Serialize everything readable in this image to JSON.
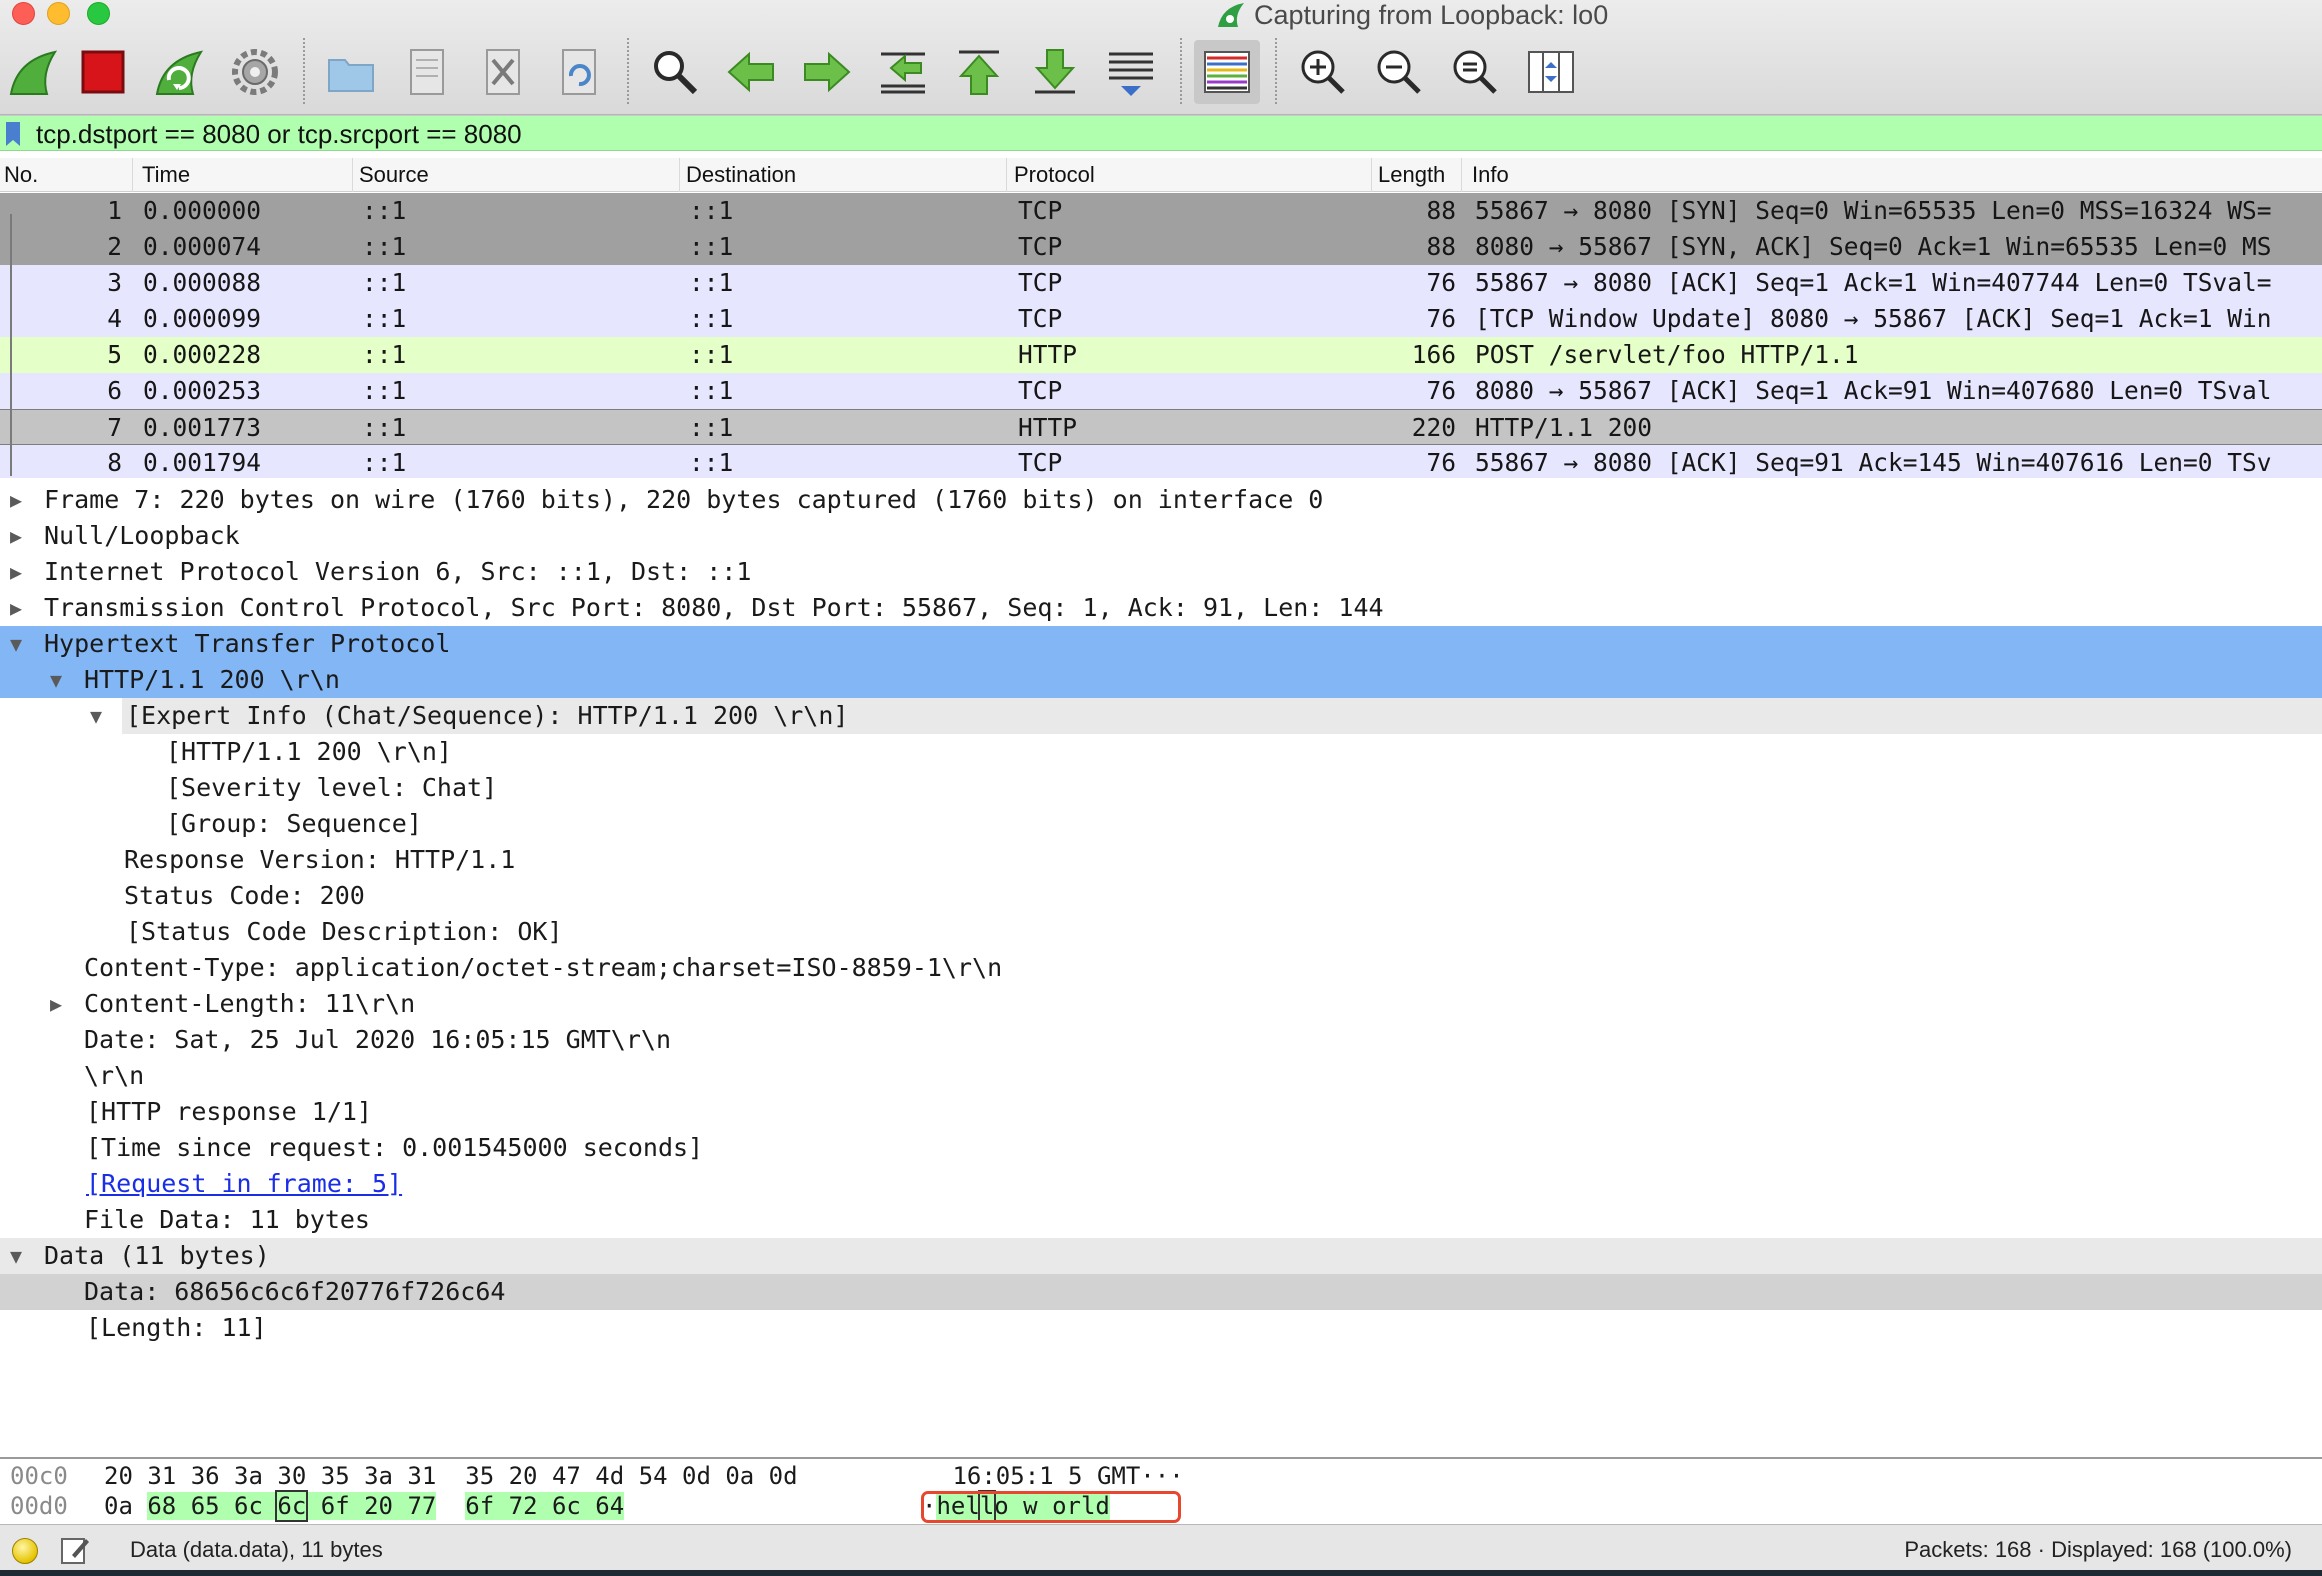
{
  "window": {
    "title": "Capturing from Loopback: lo0"
  },
  "toolbar": {
    "buttons": [
      "start-capture-icon",
      "stop-capture-icon",
      "restart-capture-icon",
      "capture-options-icon",
      "open-file-icon",
      "save-file-icon",
      "close-file-icon",
      "reload-file-icon",
      "find-packet-icon",
      "go-back-icon",
      "go-forward-icon",
      "go-to-packet-icon",
      "first-packet-icon",
      "last-packet-icon",
      "autoscroll-icon",
      "colorize-icon",
      "zoom-in-icon",
      "zoom-out-icon",
      "zoom-normal-icon",
      "resize-columns-icon"
    ]
  },
  "filter": {
    "value": "tcp.dstport == 8080 or tcp.srcport == 8080"
  },
  "packet_list": {
    "columns": {
      "no": "No.",
      "time": "Time",
      "source": "Source",
      "destination": "Destination",
      "protocol": "Protocol",
      "length": "Length",
      "info": "Info"
    },
    "rows": [
      {
        "no": "1",
        "time": "0.000000",
        "source": "::1",
        "destination": "::1",
        "protocol": "TCP",
        "length": "88",
        "info": "55867 → 8080 [SYN] Seq=0 Win=65535 Len=0 MSS=16324 WS="
      },
      {
        "no": "2",
        "time": "0.000074",
        "source": "::1",
        "destination": "::1",
        "protocol": "TCP",
        "length": "88",
        "info": "8080 → 55867 [SYN, ACK] Seq=0 Ack=1 Win=65535 Len=0 MS"
      },
      {
        "no": "3",
        "time": "0.000088",
        "source": "::1",
        "destination": "::1",
        "protocol": "TCP",
        "length": "76",
        "info": "55867 → 8080 [ACK] Seq=1 Ack=1 Win=407744 Len=0 TSval="
      },
      {
        "no": "4",
        "time": "0.000099",
        "source": "::1",
        "destination": "::1",
        "protocol": "TCP",
        "length": "76",
        "info": "[TCP Window Update] 8080 → 55867 [ACK] Seq=1 Ack=1 Win"
      },
      {
        "no": "5",
        "time": "0.000228",
        "source": "::1",
        "destination": "::1",
        "protocol": "HTTP",
        "length": "166",
        "info": "POST /servlet/foo HTTP/1.1"
      },
      {
        "no": "6",
        "time": "0.000253",
        "source": "::1",
        "destination": "::1",
        "protocol": "TCP",
        "length": "76",
        "info": "8080 → 55867 [ACK] Seq=1 Ack=91 Win=407680 Len=0 TSval"
      },
      {
        "no": "7",
        "time": "0.001773",
        "source": "::1",
        "destination": "::1",
        "protocol": "HTTP",
        "length": "220",
        "info": "HTTP/1.1 200"
      },
      {
        "no": "8",
        "time": "0.001794",
        "source": "::1",
        "destination": "::1",
        "protocol": "TCP",
        "length": "76",
        "info": "55867 → 8080 [ACK] Seq=91 Ack=145 Win=407616 Len=0 TSv"
      }
    ]
  },
  "details": {
    "frame": "Frame 7: 220 bytes on wire (1760 bits), 220 bytes captured (1760 bits) on interface 0",
    "null_loopback": "Null/Loopback",
    "ipv6": "Internet Protocol Version 6, Src: ::1, Dst: ::1",
    "tcp": "Transmission Control Protocol, Src Port: 8080, Dst Port: 55867, Seq: 1, Ack: 91, Len: 144",
    "http": "Hypertext Transfer Protocol",
    "http_status_line": "HTTP/1.1 200 \\r\\n",
    "expert_info": "[Expert Info (Chat/Sequence): HTTP/1.1 200 \\r\\n]",
    "expert_msg": "[HTTP/1.1 200 \\r\\n]",
    "severity": "[Severity level: Chat]",
    "group": "[Group: Sequence]",
    "response_version": "Response Version: HTTP/1.1",
    "status_code": "Status Code: 200",
    "status_desc": "[Status Code Description: OK]",
    "content_type": "Content-Type: application/octet-stream;charset=ISO-8859-1\\r\\n",
    "content_length": "Content-Length: 11\\r\\n",
    "date": "Date: Sat, 25 Jul 2020 16:05:15 GMT\\r\\n",
    "crlf": "\\r\\n",
    "http_response": "[HTTP response 1/1]",
    "time_since": "[Time since request: 0.001545000 seconds]",
    "request_in_frame": "[Request in frame: 5]",
    "file_data": "File Data: 11 bytes",
    "data": "Data (11 bytes)",
    "data_value": "Data: 68656c6c6f20776f726c64",
    "data_length": "[Length: 11]"
  },
  "bytes": {
    "row1": {
      "offset": "00c0",
      "hex_a": "20 31 36 3a 30 35 3a 31",
      "hex_b": "35 20 47 4d 54 0d 0a 0d",
      "ascii": " 16:05:1 5 GMT···"
    },
    "row2": {
      "offset": "00d0",
      "hex_pre": "0a ",
      "hex_sel1": "68 65 6c ",
      "hex_box": "6c",
      "hex_sel2": " 6f 20 77",
      "hex_sel3": "6f 72 6c 64",
      "ascii_pre": "·",
      "ascii_sel": "hel",
      "ascii_box": "l",
      "ascii_sel2": "o w orld"
    }
  },
  "status": {
    "left": "Data (data.data), 11 bytes",
    "right": "Packets: 168 · Displayed: 168 (100.0%)"
  }
}
